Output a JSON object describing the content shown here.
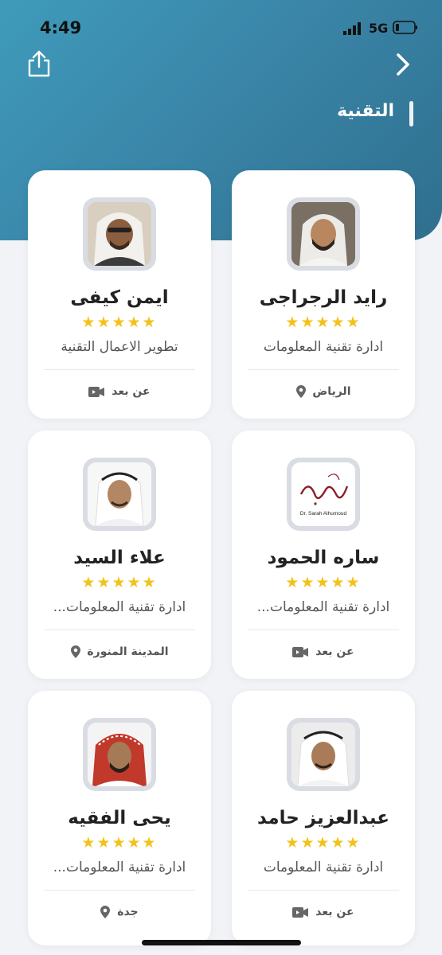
{
  "status": {
    "time": "4:49",
    "network": "5G"
  },
  "header": {
    "title": "التقنية"
  },
  "cards": [
    {
      "name": "رايد الرجراجى",
      "rating": 5,
      "stars": "★★★★★",
      "dept": "ادارة تقنية المعلومات",
      "location": "الرياض",
      "location_icon": "location-pin-icon"
    },
    {
      "name": "ايمن كيفى",
      "rating": 5,
      "stars": "★★★★★",
      "dept": "تطوير الاعمال التقنية",
      "location": "عن بعد",
      "location_icon": "video-camera-icon"
    },
    {
      "name": "ساره الحمود",
      "rating": 5,
      "stars": "★★★★★",
      "dept": "ادارة تقنية المعلومات...",
      "location": "عن بعد",
      "location_icon": "video-camera-icon",
      "logo_caption": "Dr. Sarah Alhumoud"
    },
    {
      "name": "علاء السيد",
      "rating": 5,
      "stars": "★★★★★",
      "dept": "ادارة تقنية المعلومات...",
      "location": "المدينة المنورة",
      "location_icon": "location-pin-icon"
    },
    {
      "name": "عبدالعزيز حامد",
      "rating": 5,
      "stars": "★★★★★",
      "dept": "ادارة تقنية المعلومات",
      "location": "عن بعد",
      "location_icon": "video-camera-icon"
    },
    {
      "name": "يحى الفقيه",
      "rating": 5,
      "stars": "★★★★★",
      "dept": "ادارة تقنية المعلومات...",
      "location": "جدة",
      "location_icon": "location-pin-icon"
    }
  ],
  "colors": {
    "header": "#3a86a9",
    "star": "#f2c21b",
    "background": "#f1f3f6"
  }
}
